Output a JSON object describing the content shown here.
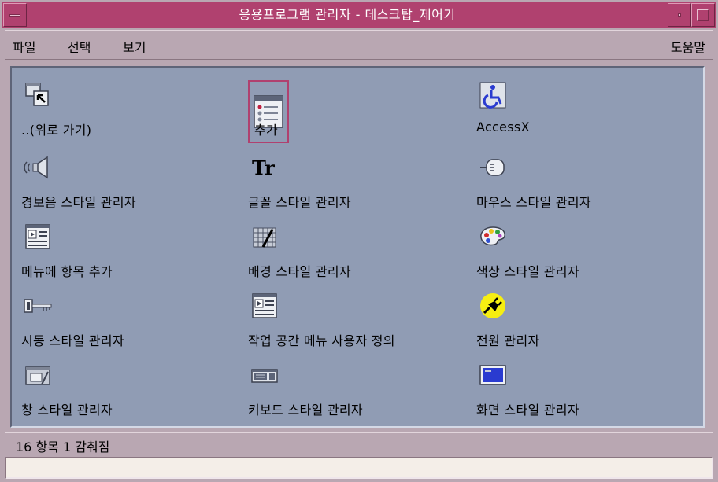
{
  "window": {
    "title": "응용프로그램 관리자 - 데스크탑_제어기"
  },
  "menubar": {
    "file": "파일",
    "select": "선택",
    "view": "보기",
    "help": "도움말"
  },
  "items": [
    {
      "label": "..(위로 가기)",
      "icon": "folder-up-icon"
    },
    {
      "label": "추가",
      "icon": "add-app-icon",
      "selected": true
    },
    {
      "label": "AccessX",
      "icon": "accessibility-icon"
    },
    {
      "label": "경보음 스타일 관리자",
      "icon": "speaker-icon"
    },
    {
      "label": "글꼴 스타일 관리자",
      "icon": "font-icon"
    },
    {
      "label": "마우스 스타일 관리자",
      "icon": "mouse-icon"
    },
    {
      "label": "메뉴에 항목 추가",
      "icon": "menu-add-icon"
    },
    {
      "label": "배경 스타일 관리자",
      "icon": "backdrop-icon"
    },
    {
      "label": "색상 스타일 관리자",
      "icon": "palette-icon"
    },
    {
      "label": "시동 스타일 관리자",
      "icon": "startup-key-icon"
    },
    {
      "label": "작업 공간 메뉴 사용자 정의",
      "icon": "workspace-menu-icon"
    },
    {
      "label": "전원 관리자",
      "icon": "power-plug-icon"
    },
    {
      "label": "창 스타일 관리자",
      "icon": "window-style-icon"
    },
    {
      "label": "키보드 스타일 관리자",
      "icon": "keyboard-icon"
    },
    {
      "label": "화면 스타일 관리자",
      "icon": "screen-icon"
    }
  ],
  "status": {
    "text": "16 항목 1 감춰짐"
  },
  "colors": {
    "titlebar": "#b0416f",
    "window_bg": "#b9a7b2",
    "content_bg": "#909cb4",
    "selection_border": "#b0416f"
  }
}
